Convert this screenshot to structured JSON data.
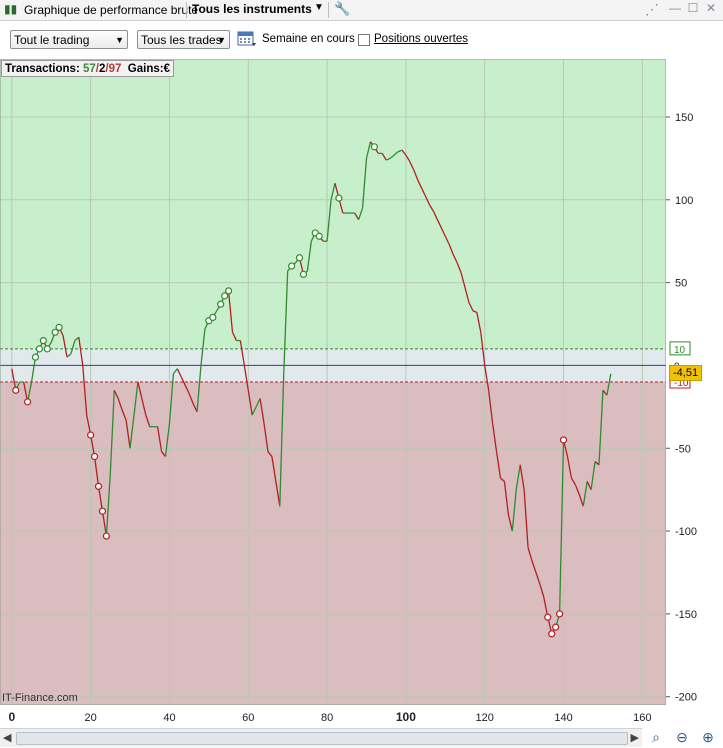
{
  "window": {
    "title": "Graphique de performance brute",
    "instrument_selector": "Tous les instruments"
  },
  "toolbar": {
    "scope_select": "Tout le trading",
    "trades_select": "Tous les trades",
    "period_label": "Semaine en cours",
    "open_positions_label": "Positions ouvertes",
    "open_positions_checked": false
  },
  "summary": {
    "label": "Transactions:",
    "wins": "57",
    "sep1": "/",
    "neutral": "2",
    "sep2": "/",
    "losses": "97",
    "gains_label": "Gains:",
    "currency": "€"
  },
  "watermark": "IT-Finance.com",
  "current_value_label": "-4,51",
  "colors": {
    "positive_zone": "#c8efcc",
    "negative_zone": "#d9bdbf",
    "band_zone": "#e1e9ed",
    "rise_line": "#2e8b2e",
    "fall_line": "#b02020",
    "zero_line": "#2c3e8c",
    "price_tag": "#f2c200"
  },
  "chart_data": {
    "type": "line",
    "x_ticks": [
      "0",
      "20",
      "40",
      "60",
      "80",
      "100",
      "120",
      "140",
      "160"
    ],
    "y_ticks": [
      "150",
      "100",
      "50",
      "-50",
      "-100",
      "-150",
      "-200"
    ],
    "band_labels": [
      "10",
      "0",
      "-10"
    ],
    "xlim": [
      -3,
      166
    ],
    "ylim": [
      -205,
      185
    ],
    "band": [
      10,
      -10
    ],
    "grid": true,
    "current_value": -4.51,
    "x": [
      0,
      1,
      2,
      3,
      4,
      5,
      6,
      7,
      8,
      9,
      10,
      11,
      12,
      13,
      14,
      15,
      16,
      17,
      18,
      19,
      20,
      21,
      22,
      23,
      24,
      25,
      26,
      27,
      28,
      29,
      30,
      31,
      32,
      33,
      34,
      35,
      36,
      37,
      38,
      39,
      40,
      41,
      42,
      43,
      44,
      45,
      46,
      47,
      48,
      49,
      50,
      51,
      52,
      53,
      54,
      55,
      56,
      57,
      58,
      59,
      60,
      61,
      62,
      63,
      64,
      65,
      66,
      67,
      68,
      69,
      70,
      71,
      72,
      73,
      74,
      75,
      76,
      77,
      78,
      79,
      80,
      81,
      82,
      83,
      84,
      85,
      86,
      87,
      88,
      89,
      90,
      91,
      92,
      93,
      94,
      95,
      96,
      97,
      98,
      99,
      100,
      101,
      102,
      103,
      104,
      105,
      106,
      107,
      108,
      109,
      110,
      111,
      112,
      113,
      114,
      115,
      116,
      117,
      118,
      119,
      120,
      121,
      122,
      123,
      124,
      125,
      126,
      127,
      128,
      129,
      130,
      131,
      132,
      133,
      134,
      135,
      136,
      137,
      138,
      139,
      140,
      141,
      142,
      143,
      144,
      145,
      146,
      147,
      148,
      149,
      150,
      151,
      152,
      153,
      154,
      155,
      156
    ],
    "values": [
      -2,
      -15,
      -10,
      -10,
      -22,
      -10,
      5,
      10,
      15,
      10,
      14,
      20,
      23,
      18,
      5,
      7,
      15,
      17,
      0,
      -30,
      -42,
      -55,
      -73,
      -88,
      -103,
      -65,
      -15,
      -20,
      -27,
      -33,
      -50,
      -30,
      -10,
      -20,
      -30,
      -37,
      -37,
      -37,
      -52,
      -55,
      -35,
      -5,
      -2,
      -7,
      -12,
      -17,
      -23,
      -28,
      0,
      22,
      27,
      29,
      33,
      37,
      42,
      45,
      20,
      15,
      15,
      0,
      -15,
      -30,
      -25,
      -20,
      -35,
      -52,
      -55,
      -70,
      -85,
      -5,
      57,
      60,
      62,
      65,
      55,
      57,
      75,
      80,
      78,
      75,
      75,
      100,
      110,
      101,
      92,
      92,
      92,
      92,
      88,
      95,
      125,
      135,
      132,
      128,
      128,
      124,
      125,
      127,
      129,
      130,
      127,
      123,
      118,
      112,
      107,
      102,
      97,
      93,
      88,
      83,
      78,
      73,
      67,
      62,
      56,
      47,
      38,
      33,
      32,
      20,
      0,
      -15,
      -35,
      -52,
      -68,
      -70,
      -90,
      -100,
      -75,
      -60,
      -75,
      -110,
      -118,
      -125,
      -132,
      -140,
      -152,
      -162,
      -158,
      -150,
      -45,
      -55,
      -68,
      -72,
      -78,
      -85,
      -70,
      -75,
      -58,
      -60,
      -15,
      -18,
      -5
    ],
    "markers_high": [
      6,
      7,
      8,
      9,
      11,
      12,
      50,
      51,
      53,
      54,
      55,
      71,
      73,
      74,
      77,
      78,
      83,
      92
    ],
    "markers_low": [
      1,
      4,
      20,
      21,
      22,
      23,
      24,
      136,
      137,
      138,
      139,
      140
    ]
  }
}
